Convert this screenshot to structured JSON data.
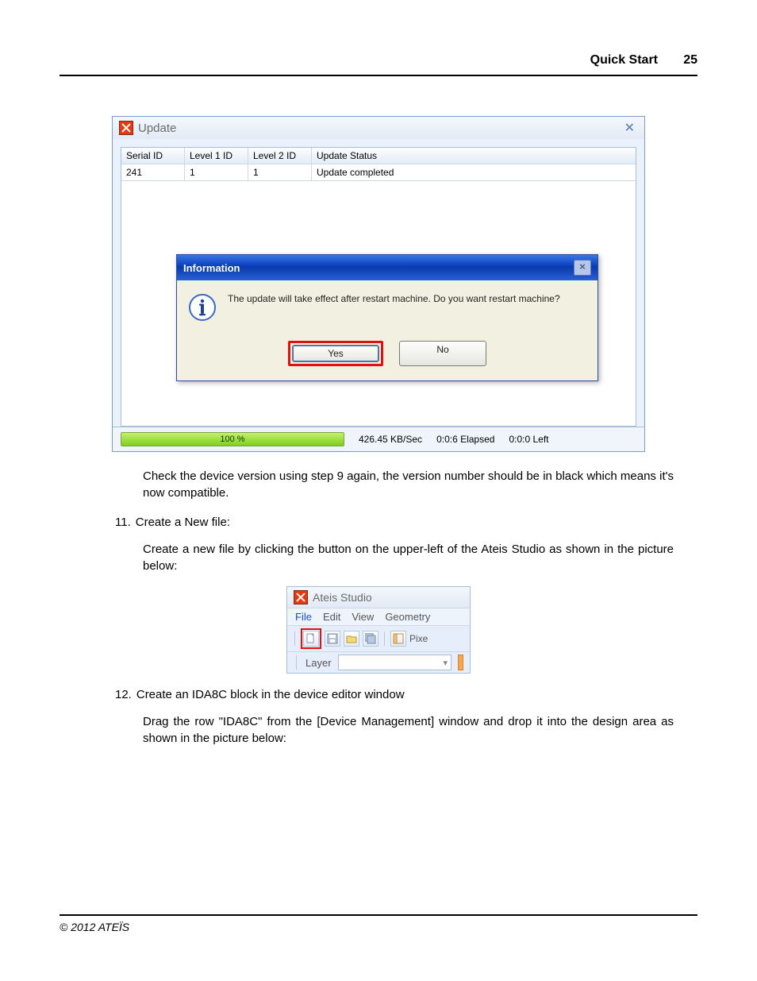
{
  "header": {
    "title": "Quick Start",
    "page": "25"
  },
  "footer": {
    "copyright": "© 2012 ATEÏS"
  },
  "update_window": {
    "title": "Update",
    "columns": {
      "serial": "Serial ID",
      "l1": "Level 1 ID",
      "l2": "Level 2 ID",
      "status": "Update Status"
    },
    "rows": [
      {
        "serial": "241",
        "l1": "1",
        "l2": "1",
        "status": "Update completed"
      }
    ],
    "progress_pct": "100 %",
    "rate": "426.45 KB/Sec",
    "elapsed": "0:0:6 Elapsed",
    "left": "0:0:0 Left"
  },
  "info_dialog": {
    "title": "Information",
    "message": "The update will take effect after restart machine. Do you want restart machine?",
    "yes": "Yes",
    "no": "No"
  },
  "para_after_update": "Check the device version using step 9 again, the version number should be in black which means it's now compatible.",
  "step11": {
    "num": "11.",
    "title": "Create a New file:",
    "para": "Create a new file by clicking the button on the upper-left of the Ateis Studio as shown in the picture below:"
  },
  "studio_window": {
    "title": "Ateis Studio",
    "menu": {
      "file": "File",
      "edit": "Edit",
      "view": "View",
      "geometry": "Geometry"
    },
    "pixe": "Pixe",
    "layer_label": "Layer",
    "combo_caret": "▾"
  },
  "step12": {
    "num": "12.",
    "title": "Create an IDA8C block in the device editor window",
    "para": "Drag the row \"IDA8C\" from the [Device Management] window and drop it into the design area as shown in the picture below:"
  }
}
